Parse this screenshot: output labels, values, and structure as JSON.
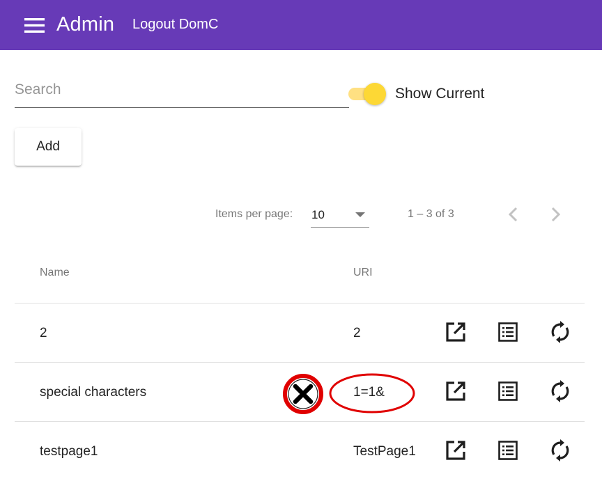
{
  "toolbar": {
    "menu_icon": "menu-icon",
    "title": "Admin",
    "logout_label": "Logout DomC",
    "background_color": "#673ab7"
  },
  "search": {
    "placeholder": "Search",
    "value": ""
  },
  "show_current": {
    "label": "Show Current",
    "checked": true,
    "accent_color": "#fdd835"
  },
  "add_button": {
    "label": "Add"
  },
  "paginator": {
    "items_per_page_label": "Items per page:",
    "page_size": "10",
    "range_label": "1 – 3 of 3",
    "prev_icon": "chevron-left-icon",
    "next_icon": "chevron-right-icon"
  },
  "table": {
    "columns": [
      "Name",
      "URI"
    ],
    "rows": [
      {
        "name": "2",
        "uri": "2",
        "actions": [
          "open-in-new-icon",
          "list-icon",
          "refresh-icon"
        ]
      },
      {
        "name": "special characters",
        "uri": "1=1&",
        "actions": [
          "open-in-new-icon",
          "list-icon",
          "refresh-icon"
        ]
      },
      {
        "name": "testpage1",
        "uri": "TestPage1",
        "actions": [
          "open-in-new-icon",
          "list-icon",
          "refresh-icon"
        ]
      }
    ]
  },
  "annotations": {
    "error_marker_icon": "x-error-icon",
    "highlight_color": "#e00000"
  }
}
